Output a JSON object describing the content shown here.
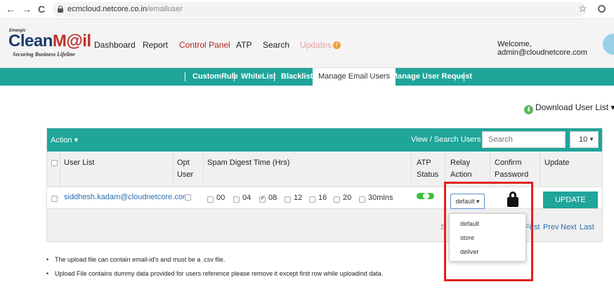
{
  "browser": {
    "back": "←",
    "forward": "→",
    "reload": "C",
    "url_host": "ecmcloud.netcore.co.in",
    "url_path": "/emailuser",
    "star": "☆"
  },
  "header": {
    "logo_prefix": "Emergic",
    "logo_part1": "Clean",
    "logo_part2": "M@il",
    "logo_tagline": "Securing Business Lifeline",
    "nav": [
      "Dashboard",
      "Report",
      "Control Panel",
      "ATP",
      "Search",
      "Updates"
    ],
    "updates_badge": "!",
    "welcome": "Welcome, admin@cloudnetcore.com"
  },
  "subnav": {
    "items": [
      "CustomRule",
      "WhiteList",
      "Blacklist",
      "Manage Email Users",
      "Manage User Request"
    ],
    "active": "Manage Email Users"
  },
  "download": {
    "label": "Download User List",
    "icon": "download-circle",
    "caret": "▾"
  },
  "panel": {
    "action_label": "Action ▾",
    "view_search_label": "View / Search Users :",
    "search_placeholder": "Search",
    "page_size": "10",
    "columns": {
      "user_list": "User List",
      "opt_user": "Opt User",
      "spam_digest": "Spam Digest Time (Hrs)",
      "atp_status": "ATP Status",
      "relay_action": "Relay Action",
      "confirm_password": "Confirm Password",
      "update": "Update"
    },
    "row": {
      "email": "siddhesh.kadam@cloudnetcore.com",
      "digest_options": [
        {
          "label": "00",
          "checked": false
        },
        {
          "label": "04",
          "checked": false
        },
        {
          "label": "08",
          "checked": true
        },
        {
          "label": "12",
          "checked": false
        },
        {
          "label": "16",
          "checked": false
        },
        {
          "label": "20",
          "checked": false
        },
        {
          "label": "30mins",
          "checked": false
        }
      ],
      "atp_status_on": true,
      "relay_value": "default ▾",
      "update_label": "UPDATE"
    },
    "pager": {
      "partial_left": "S",
      "first": "First",
      "prev": "Prev",
      "next": "Next",
      "last": "Last"
    }
  },
  "relay_dropdown": {
    "options": [
      "default",
      "store",
      "deliver"
    ]
  },
  "notes": [
    "The upload file can contain email-id's and must be a .csv file.",
    "Upload File contains dummy data provided for users reference please remove it except first row while uploadind data."
  ],
  "colors": {
    "teal": "#1fa59a",
    "highlight_red": "#e02020",
    "link_blue": "#2a6fb0"
  }
}
